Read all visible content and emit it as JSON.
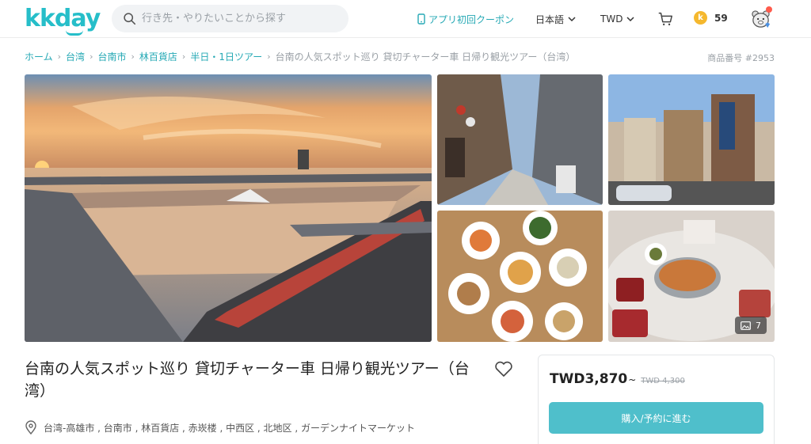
{
  "header": {
    "logo": "kkday",
    "search_placeholder": "行き先・やりたいことから探す",
    "coupon_label": "アプリ初回クーポン",
    "language": "日本語",
    "currency": "TWD",
    "points": "59",
    "coin_icon_letter": "k"
  },
  "breadcrumb": {
    "items": [
      "ホーム",
      "台湾",
      "台南市",
      "林百貨店",
      "半日・1日ツアー"
    ],
    "current": "台南の人気スポット巡り 貸切チャーター車 日帰り観光ツアー（台湾）",
    "product_no": "商品番号 #2953"
  },
  "gallery": {
    "photo_count": "7"
  },
  "product": {
    "title": "台南の人気スポット巡り 貸切チャーター車 日帰り観光ツアー（台湾）",
    "location": "台湾-高雄市 , 台南市 , 林百貨店 , 赤崁楼 , 中西区 , 北地区 , ガーデンナイトマーケット"
  },
  "pricing": {
    "price": "TWD3,870",
    "suffix": "~",
    "original_price": "TWD 4,300",
    "book_label": "購入/予約に進む"
  },
  "colors": {
    "brand": "#26bec9",
    "button": "#4fbfcb",
    "link": "#26a9b5"
  }
}
